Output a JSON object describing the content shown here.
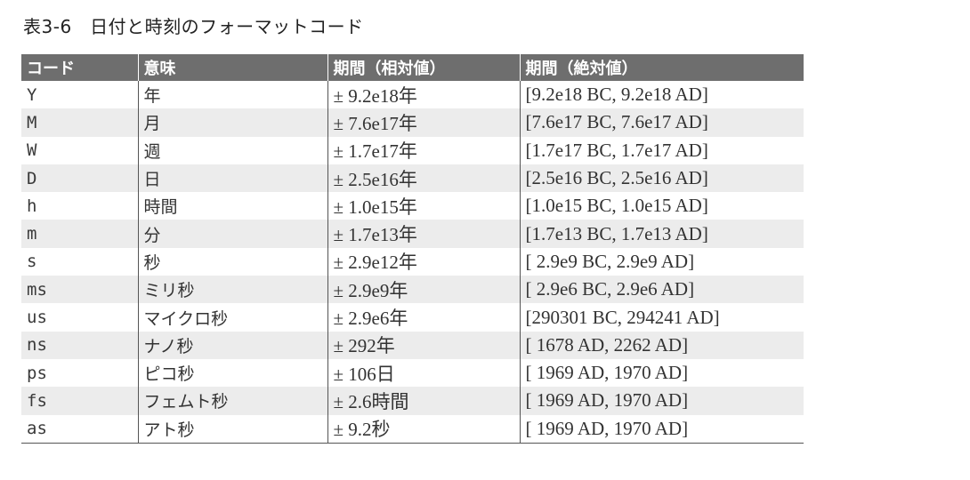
{
  "caption": "表3-6　日付と時刻のフォーマットコード",
  "headers": [
    "コード",
    "意味",
    "期間（相対値）",
    "期間（絶対値）"
  ],
  "rows": [
    [
      "Y",
      "年",
      "± 9.2e18年",
      "[9.2e18 BC, 9.2e18 AD]"
    ],
    [
      "M",
      "月",
      "± 7.6e17年",
      "[7.6e17 BC, 7.6e17 AD]"
    ],
    [
      "W",
      "週",
      "± 1.7e17年",
      "[1.7e17 BC, 1.7e17 AD]"
    ],
    [
      "D",
      "日",
      "± 2.5e16年",
      "[2.5e16 BC, 2.5e16 AD]"
    ],
    [
      "h",
      "時間",
      "± 1.0e15年",
      "[1.0e15 BC, 1.0e15 AD]"
    ],
    [
      "m",
      "分",
      "± 1.7e13年",
      "[1.7e13 BC, 1.7e13 AD]"
    ],
    [
      "s",
      "秒",
      "± 2.9e12年",
      "[ 2.9e9 BC, 2.9e9 AD]"
    ],
    [
      "ms",
      "ミリ秒",
      "± 2.9e9年",
      "[ 2.9e6 BC, 2.9e6 AD]"
    ],
    [
      "us",
      "マイクロ秒",
      "± 2.9e6年",
      "[290301 BC, 294241 AD]"
    ],
    [
      "ns",
      "ナノ秒",
      "± 292年",
      "[ 1678 AD, 2262 AD]"
    ],
    [
      "ps",
      "ピコ秒",
      "± 106日",
      "[ 1969 AD, 1970 AD]"
    ],
    [
      "fs",
      "フェムト秒",
      "± 2.6時間",
      "[ 1969 AD, 1970 AD]"
    ],
    [
      "as",
      "アト秒",
      "± 9.2秒",
      "[ 1969 AD, 1970 AD]"
    ]
  ]
}
